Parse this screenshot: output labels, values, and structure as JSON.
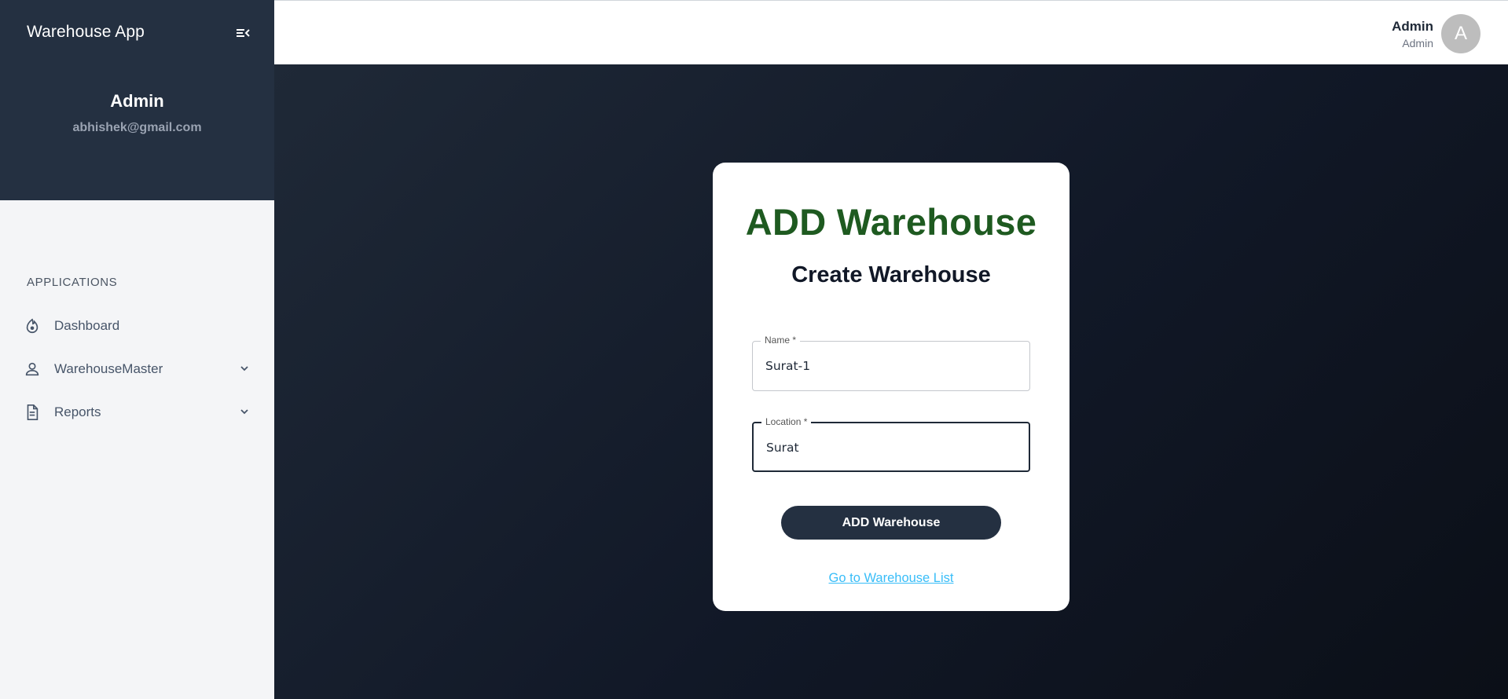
{
  "sidebar": {
    "app_title": "Warehouse App",
    "profile": {
      "name": "Admin",
      "email": "abhishek@gmail.com"
    },
    "section_label": "APPLICATIONS",
    "items": [
      {
        "label": "Dashboard",
        "icon": "dashboard-icon",
        "expandable": false
      },
      {
        "label": "WarehouseMaster",
        "icon": "person-icon",
        "expandable": true
      },
      {
        "label": "Reports",
        "icon": "document-icon",
        "expandable": true
      }
    ]
  },
  "topbar": {
    "user_name": "Admin",
    "user_role": "Admin",
    "avatar_letter": "A"
  },
  "form": {
    "title": "ADD Warehouse",
    "subtitle": "Create Warehouse",
    "name_field": {
      "label": "Name *",
      "value": "Surat-1"
    },
    "location_field": {
      "label": "Location *",
      "value": "Surat"
    },
    "submit_label": "ADD Warehouse",
    "link_label": "Go to Warehouse List"
  },
  "colors": {
    "sidebar_header": "#243041",
    "title_green": "#1e5a20",
    "link_blue": "#38bdf8",
    "button_bg": "#243041"
  }
}
